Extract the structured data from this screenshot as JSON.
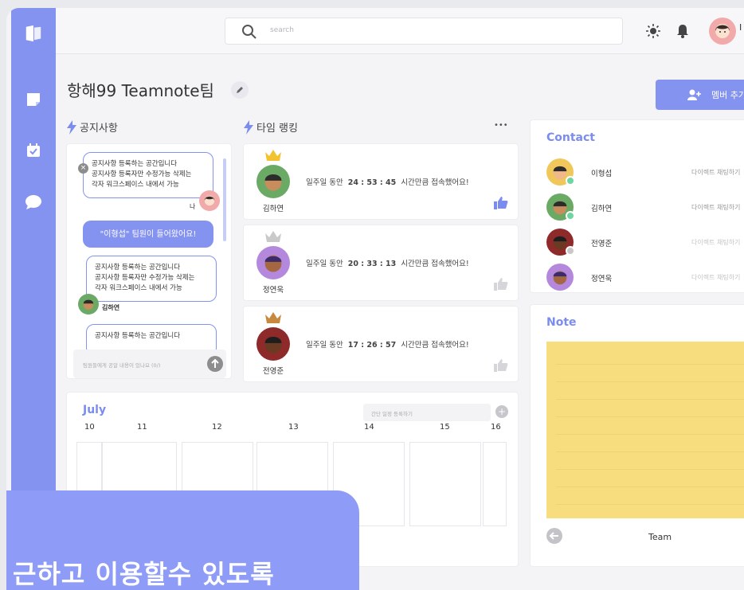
{
  "search": {
    "placeholder": "search"
  },
  "header": {
    "user_initial": "I"
  },
  "team": {
    "title": "항해99 Teamnote팀",
    "add_member_label": "멤버 추가"
  },
  "notice": {
    "title": "공지사항",
    "messages": [
      {
        "text": "공지사항 등록하는 공간입니다\n공지사항 등록자만 수정가능 삭제는\n각자 워크스페이스 내에서 가능",
        "author": "나"
      },
      {
        "text": "\"이형섭\" 팀원이 들어왔어요!"
      },
      {
        "text": "공지사항 등록하는 공간입니다\n공지사항 등록자만 수정가능 삭제는\n각자 워크스페이스 내에서 가능",
        "author": "김하연"
      },
      {
        "text": "공지사항 등록하는 공간입니다"
      }
    ],
    "input_placeholder": "팀원들에게 공알 내용이 있나요 (0/)"
  },
  "ranking": {
    "title": "타임 랭킹",
    "more": "•••",
    "items": [
      {
        "name": "김하연",
        "prefix": "일주일 동안",
        "time": "24 : 53 : 45",
        "suffix": "시간만큼 접속했어요!",
        "crown": "gold",
        "liked": true
      },
      {
        "name": "정연욱",
        "prefix": "일주일 동안",
        "time": "20 : 33 : 13",
        "suffix": "시간만큼 접속했어요!",
        "crown": "silver",
        "liked": false
      },
      {
        "name": "전영준",
        "prefix": "일주일 동안",
        "time": "17 : 26 : 57",
        "suffix": "시간만큼 접속했어요!",
        "crown": "bronze",
        "liked": false
      }
    ]
  },
  "contact": {
    "title": "Contact",
    "items": [
      {
        "name": "이형섭",
        "action": "다이렉트 채팅하기",
        "status": "online"
      },
      {
        "name": "김하연",
        "action": "다이렉트 채팅하기",
        "status": "online"
      },
      {
        "name": "전영준",
        "action": "다이렉트 채팅하기",
        "status": "offline"
      },
      {
        "name": "정연욱",
        "action": "다이렉트 채팅하기",
        "status": "offline"
      }
    ]
  },
  "calendar": {
    "month": "July",
    "input_placeholder": "간단 일정 등록하기",
    "days": [
      "10",
      "11",
      "12",
      "13",
      "14",
      "15",
      "16"
    ]
  },
  "note": {
    "title": "Note",
    "footer_label": "Team"
  },
  "banner": {
    "text": "근하고 이용할수 있도록"
  },
  "colors": {
    "accent": "#8593f0",
    "note": "#f7dd7e",
    "online": "#6fd6a1",
    "offline": "#c8c8c8"
  }
}
